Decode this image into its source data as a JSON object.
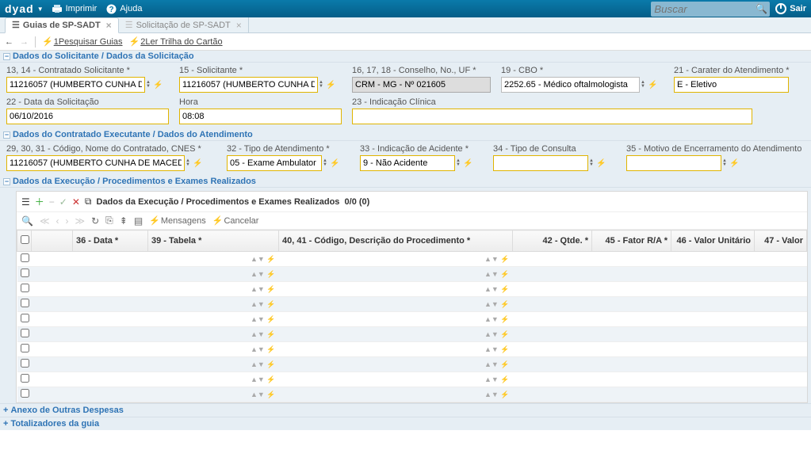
{
  "top": {
    "logo": "dyad",
    "print": "Imprimir",
    "help": "Ajuda",
    "search_placeholder": "Buscar",
    "exit": "Sair"
  },
  "tabs": {
    "t1": "Guias de SP-SADT",
    "t2": "Solicitação de SP-SADT"
  },
  "toolbar": {
    "a1": "1Pesquisar Guias",
    "a2": "2Ler Trilha do Cartão"
  },
  "sections": {
    "s1": "Dados do Solicitante / Dados da Solicitação",
    "s2": "Dados do Contratado Executante / Dados do Atendimento",
    "s3": "Dados da Execução / Procedimentos e Exames Realizados",
    "anexo": "Anexo de Outras Despesas",
    "total": "Totalizadores da guia"
  },
  "f": {
    "l13": "13, 14 - Contratado Solicitante *",
    "v13": "11216057 (HUMBERTO CUNHA D",
    "l15": "15 - Solicitante *",
    "v15": "11216057 (HUMBERTO CUNHA D",
    "l16": "16, 17, 18 - Conselho, No., UF *",
    "v16": "CRM - MG - Nº 021605",
    "l19": "19 - CBO *",
    "v19": "2252.65 - Médico oftalmologista",
    "l21": "21 - Carater do Atendimento *",
    "v21": "E - Eletivo",
    "l22": "22 - Data da Solicitação",
    "v22": "06/10/2016",
    "lhora": "Hora",
    "vhora": "08:08",
    "l23": "23 - Indicação Clínica",
    "v23": "",
    "l29": "29, 30, 31 - Código, Nome do Contratado, CNES *",
    "v29": "11216057 (HUMBERTO CUNHA DE MACED",
    "l32": "32 - Tipo de Atendimento *",
    "v32": "05 - Exame Ambulator",
    "l33": "33 - Indicação de Acidente *",
    "v33": "9 - Não Acidente",
    "l34": "34 - Tipo de Consulta",
    "v34": "",
    "l35": "35 - Motivo de Encerramento do Atendimento",
    "v35": ""
  },
  "grid": {
    "title": "Dados da Execução / Procedimentos e Exames Realizados",
    "count": "0/0 (0)",
    "msg": "Mensagens",
    "cancel": "Cancelar",
    "cols": {
      "c36": "36 - Data *",
      "c39": "39 - Tabela *",
      "c40": "40, 41 - Código, Descrição do Procedimento *",
      "c42": "42 - Qtde. *",
      "c45": "45 - Fator R/A *",
      "c46": "46 - Valor Unitário",
      "c47": "47 - Valor"
    }
  }
}
